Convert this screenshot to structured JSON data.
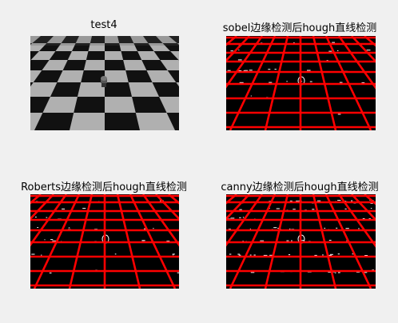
{
  "figure": {
    "panels": [
      {
        "title": "test4",
        "content": "checkerboard-photo"
      },
      {
        "title": "sobel边缘检测后hough直线检测",
        "content": "edge-map-with-hough-lines"
      },
      {
        "title": "Roberts边缘检测后hough直线检测",
        "content": "edge-map-with-hough-lines"
      },
      {
        "title": "canny边缘检测后hough直线检测",
        "content": "edge-map-with-hough-lines"
      }
    ]
  },
  "colors": {
    "background": "#f0f0f0",
    "hough_line": "#ff0000",
    "edge_background": "#000000",
    "edge_pixels": "#ffffff",
    "checker_dark": "#111111",
    "checker_light": "#b0b0b0"
  }
}
